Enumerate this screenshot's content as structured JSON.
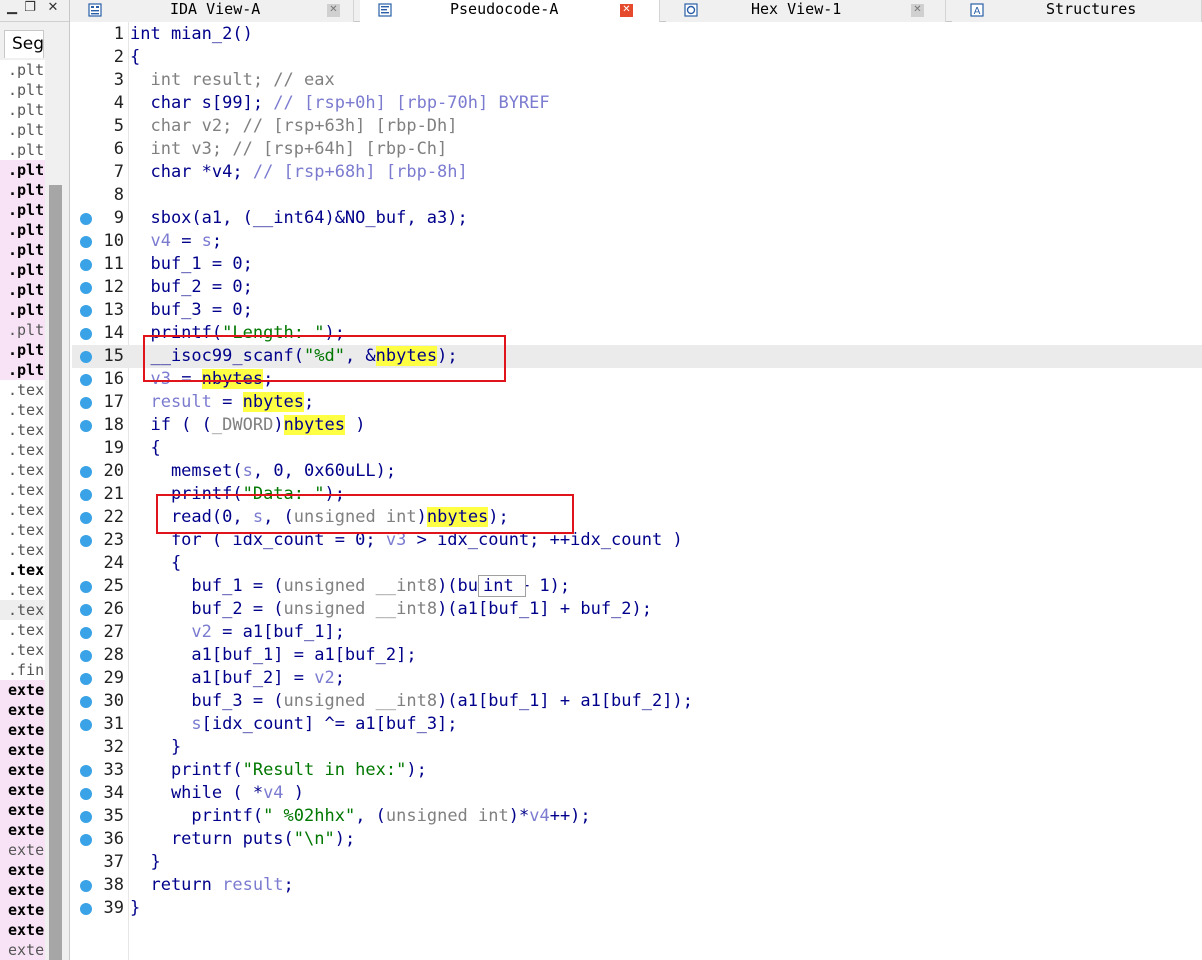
{
  "left_panel": {
    "tab_label": "Seg",
    "segments": [
      {
        "label": ".plt",
        "style": "plain"
      },
      {
        "label": ".plt",
        "style": "plain"
      },
      {
        "label": ".plt",
        "style": "plain"
      },
      {
        "label": ".plt",
        "style": "plain"
      },
      {
        "label": ".plt",
        "style": "plain"
      },
      {
        "label": ".plt",
        "style": "pinkbold"
      },
      {
        "label": ".plt",
        "style": "pinkbold"
      },
      {
        "label": ".plt",
        "style": "pinkbold"
      },
      {
        "label": ".plt",
        "style": "pinkbold"
      },
      {
        "label": ".plt",
        "style": "pinkbold"
      },
      {
        "label": ".plt",
        "style": "pinkbold"
      },
      {
        "label": ".plt",
        "style": "pinkbold"
      },
      {
        "label": ".plt",
        "style": "pinkbold"
      },
      {
        "label": ".plt",
        "style": "pink"
      },
      {
        "label": ".plt",
        "style": "pinkbold"
      },
      {
        "label": ".plt",
        "style": "pinkbold"
      },
      {
        "label": ".text",
        "style": "plain"
      },
      {
        "label": ".text",
        "style": "plain"
      },
      {
        "label": ".text",
        "style": "plain"
      },
      {
        "label": ".text",
        "style": "plain"
      },
      {
        "label": ".text",
        "style": "plain"
      },
      {
        "label": ".text",
        "style": "plain"
      },
      {
        "label": ".text",
        "style": "plain"
      },
      {
        "label": ".text",
        "style": "plain"
      },
      {
        "label": ".text",
        "style": "plain"
      },
      {
        "label": ".text",
        "style": "bold"
      },
      {
        "label": ".text",
        "style": "plain"
      },
      {
        "label": ".text",
        "style": "gray"
      },
      {
        "label": ".text",
        "style": "plain"
      },
      {
        "label": ".text",
        "style": "plain"
      },
      {
        "label": ".fini",
        "style": "plain"
      },
      {
        "label": "extern",
        "style": "pinkbold"
      },
      {
        "label": "extern",
        "style": "pinkbold"
      },
      {
        "label": "extern",
        "style": "pinkbold"
      },
      {
        "label": "extern",
        "style": "pinkbold"
      },
      {
        "label": "extern",
        "style": "pinkbold"
      },
      {
        "label": "extern",
        "style": "pinkbold"
      },
      {
        "label": "extern",
        "style": "pinkbold"
      },
      {
        "label": "extern",
        "style": "pinkbold"
      },
      {
        "label": "extern",
        "style": "pinkplain"
      },
      {
        "label": "extern",
        "style": "pinkbold"
      },
      {
        "label": "extern",
        "style": "pinkbold"
      },
      {
        "label": "extern",
        "style": "pinkbold"
      },
      {
        "label": "extern",
        "style": "pinkbold"
      },
      {
        "label": "extern",
        "style": "pinkplain"
      }
    ]
  },
  "tabs": [
    {
      "label": "IDA View-A",
      "icon": "ida-view-icon",
      "active": false
    },
    {
      "label": "Pseudocode-A",
      "icon": "pseudocode-icon",
      "active": true
    },
    {
      "label": "Hex View-1",
      "icon": "hex-view-icon",
      "active": false
    },
    {
      "label": "Structures",
      "icon": "structures-icon",
      "active": false
    }
  ],
  "colors": {
    "keyword": "#00008b",
    "comment_or_var": "#7b7bd0",
    "string": "#007700",
    "highlight": "#ffff44",
    "breakpoint_dot": "#3aa2e6",
    "annotation_box": "#e0141a"
  },
  "code_lines": [
    {
      "num": "1",
      "dot": false,
      "hl": false,
      "tokens": [
        [
          "n",
          "int mian_2()"
        ]
      ]
    },
    {
      "num": "2",
      "dot": false,
      "hl": false,
      "tokens": [
        [
          "n",
          "{"
        ]
      ]
    },
    {
      "num": "3",
      "dot": false,
      "hl": false,
      "tokens": [
        [
          "g",
          "  int result; // eax"
        ]
      ]
    },
    {
      "num": "4",
      "dot": false,
      "hl": false,
      "tokens": [
        [
          "n",
          "  char s[99]; "
        ],
        [
          "c",
          "// [rsp+0h] [rbp-70h] BYREF"
        ]
      ]
    },
    {
      "num": "5",
      "dot": false,
      "hl": false,
      "tokens": [
        [
          "g",
          "  char v2; // [rsp+63h] [rbp-Dh]"
        ]
      ]
    },
    {
      "num": "6",
      "dot": false,
      "hl": false,
      "tokens": [
        [
          "g",
          "  int v3; // [rsp+64h] [rbp-Ch]"
        ]
      ]
    },
    {
      "num": "7",
      "dot": false,
      "hl": false,
      "tokens": [
        [
          "n",
          "  char *v4; "
        ],
        [
          "c",
          "// [rsp+68h] [rbp-8h]"
        ]
      ]
    },
    {
      "num": "8",
      "dot": false,
      "hl": false,
      "tokens": [
        [
          "n",
          ""
        ]
      ]
    },
    {
      "num": "9",
      "dot": true,
      "hl": false,
      "tokens": [
        [
          "n",
          "  sbox(a1, (__int64)&NO_buf, a3);"
        ]
      ]
    },
    {
      "num": "10",
      "dot": true,
      "hl": false,
      "tokens": [
        [
          "v",
          "  v4"
        ],
        [
          "n",
          " = "
        ],
        [
          "v",
          "s"
        ],
        [
          "n",
          ";"
        ]
      ]
    },
    {
      "num": "11",
      "dot": true,
      "hl": false,
      "tokens": [
        [
          "n",
          "  buf_1 = 0;"
        ]
      ]
    },
    {
      "num": "12",
      "dot": true,
      "hl": false,
      "tokens": [
        [
          "n",
          "  buf_2 = 0;"
        ]
      ]
    },
    {
      "num": "13",
      "dot": true,
      "hl": false,
      "tokens": [
        [
          "n",
          "  buf_3 = 0;"
        ]
      ]
    },
    {
      "num": "14",
      "dot": true,
      "hl": false,
      "tokens": [
        [
          "n",
          "  printf("
        ],
        [
          "s",
          "\"Length: \""
        ],
        [
          "n",
          ");"
        ]
      ]
    },
    {
      "num": "15",
      "dot": true,
      "hl": true,
      "tokens": [
        [
          "n",
          "  __isoc99_scanf("
        ],
        [
          "s",
          "\"%d\""
        ],
        [
          "n",
          ", &"
        ],
        [
          "y",
          "nbytes"
        ],
        [
          "n",
          ");"
        ]
      ]
    },
    {
      "num": "16",
      "dot": true,
      "hl": false,
      "tokens": [
        [
          "v",
          "  v3"
        ],
        [
          "n",
          " = "
        ],
        [
          "y",
          "nbytes"
        ],
        [
          "n",
          ";"
        ]
      ]
    },
    {
      "num": "17",
      "dot": true,
      "hl": false,
      "tokens": [
        [
          "v",
          "  result"
        ],
        [
          "n",
          " = "
        ],
        [
          "y",
          "nbytes"
        ],
        [
          "n",
          ";"
        ]
      ]
    },
    {
      "num": "18",
      "dot": true,
      "hl": false,
      "tokens": [
        [
          "n",
          "  if ( ("
        ],
        [
          "g",
          "_DWORD"
        ],
        [
          "n",
          ")"
        ],
        [
          "y",
          "nbytes"
        ],
        [
          "n",
          " )"
        ]
      ]
    },
    {
      "num": "19",
      "dot": false,
      "hl": false,
      "tokens": [
        [
          "n",
          "  {"
        ]
      ]
    },
    {
      "num": "20",
      "dot": true,
      "hl": false,
      "tokens": [
        [
          "n",
          "    memset("
        ],
        [
          "v",
          "s"
        ],
        [
          "n",
          ", 0, 0x60uLL);"
        ]
      ]
    },
    {
      "num": "21",
      "dot": true,
      "hl": false,
      "tokens": [
        [
          "n",
          "    printf("
        ],
        [
          "s",
          "\"Data: \""
        ],
        [
          "n",
          ");"
        ]
      ]
    },
    {
      "num": "22",
      "dot": true,
      "hl": false,
      "tokens": [
        [
          "n",
          "    read(0, "
        ],
        [
          "v",
          "s"
        ],
        [
          "n",
          ", ("
        ],
        [
          "g",
          "unsigned int"
        ],
        [
          "n",
          ")"
        ],
        [
          "y",
          "nbytes"
        ],
        [
          "n",
          ");"
        ]
      ]
    },
    {
      "num": "23",
      "dot": true,
      "hl": false,
      "tokens": [
        [
          "n",
          "    for ( idx_count = 0; "
        ],
        [
          "v",
          "v3"
        ],
        [
          "n",
          " > idx_count; ++idx_count )"
        ]
      ]
    },
    {
      "num": "24",
      "dot": false,
      "hl": false,
      "tokens": [
        [
          "n",
          "    {"
        ]
      ]
    },
    {
      "num": "25",
      "dot": true,
      "hl": false,
      "tokens": [
        [
          "n",
          "      buf_1 = ("
        ],
        [
          "g",
          "unsigned __int8"
        ],
        [
          "n",
          ")(buf_1 + 1);"
        ]
      ]
    },
    {
      "num": "26",
      "dot": true,
      "hl": false,
      "tokens": [
        [
          "n",
          "      buf_2 = ("
        ],
        [
          "g",
          "unsigned __int8"
        ],
        [
          "n",
          ")(a1[buf_1] + buf_2);"
        ]
      ]
    },
    {
      "num": "27",
      "dot": true,
      "hl": false,
      "tokens": [
        [
          "v",
          "      v2"
        ],
        [
          "n",
          " = a1[buf_1];"
        ]
      ]
    },
    {
      "num": "28",
      "dot": true,
      "hl": false,
      "tokens": [
        [
          "n",
          "      a1[buf_1] = a1[buf_2];"
        ]
      ]
    },
    {
      "num": "29",
      "dot": true,
      "hl": false,
      "tokens": [
        [
          "n",
          "      a1[buf_2] = "
        ],
        [
          "v",
          "v2"
        ],
        [
          "n",
          ";"
        ]
      ]
    },
    {
      "num": "30",
      "dot": true,
      "hl": false,
      "tokens": [
        [
          "n",
          "      buf_3 = ("
        ],
        [
          "g",
          "unsigned __int8"
        ],
        [
          "n",
          ")(a1[buf_1] + a1[buf_2]);"
        ]
      ]
    },
    {
      "num": "31",
      "dot": true,
      "hl": false,
      "tokens": [
        [
          "v",
          "      s"
        ],
        [
          "n",
          "[idx_count] ^= a1[buf_3];"
        ]
      ]
    },
    {
      "num": "32",
      "dot": false,
      "hl": false,
      "tokens": [
        [
          "n",
          "    }"
        ]
      ]
    },
    {
      "num": "33",
      "dot": true,
      "hl": false,
      "tokens": [
        [
          "n",
          "    printf("
        ],
        [
          "s",
          "\"Result in hex:\""
        ],
        [
          "n",
          ");"
        ]
      ]
    },
    {
      "num": "34",
      "dot": true,
      "hl": false,
      "tokens": [
        [
          "n",
          "    while ( *"
        ],
        [
          "v",
          "v4"
        ],
        [
          "n",
          " )"
        ]
      ]
    },
    {
      "num": "35",
      "dot": true,
      "hl": false,
      "tokens": [
        [
          "n",
          "      printf("
        ],
        [
          "s",
          "\" %02hhx\""
        ],
        [
          "n",
          ", ("
        ],
        [
          "g",
          "unsigned int"
        ],
        [
          "n",
          ")*"
        ],
        [
          "v",
          "v4"
        ],
        [
          "n",
          "++);"
        ]
      ]
    },
    {
      "num": "36",
      "dot": true,
      "hl": false,
      "tokens": [
        [
          "n",
          "    return puts("
        ],
        [
          "s",
          "\"\\n\""
        ],
        [
          "n",
          ");"
        ]
      ]
    },
    {
      "num": "37",
      "dot": false,
      "hl": false,
      "tokens": [
        [
          "n",
          "  }"
        ]
      ]
    },
    {
      "num": "38",
      "dot": true,
      "hl": false,
      "tokens": [
        [
          "n",
          "  return "
        ],
        [
          "v",
          "result"
        ],
        [
          "n",
          ";"
        ]
      ]
    },
    {
      "num": "39",
      "dot": true,
      "hl": false,
      "tokens": [
        [
          "n",
          "}"
        ]
      ]
    }
  ],
  "caret_tooltip": "int"
}
